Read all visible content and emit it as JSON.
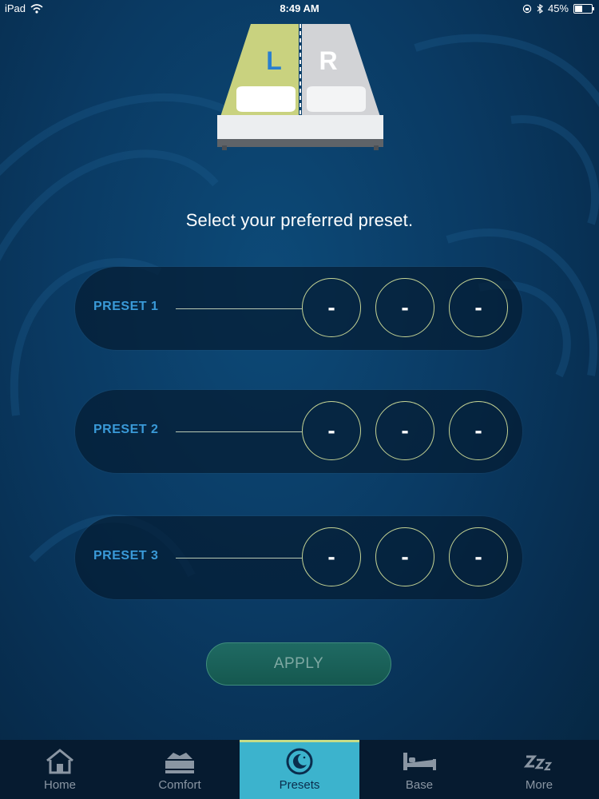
{
  "status_bar": {
    "device": "iPad",
    "time": "8:49 AM",
    "battery": "45%",
    "battery_level": 0.45
  },
  "bed": {
    "left_label": "L",
    "right_label": "R",
    "selected_side": "L"
  },
  "title": "Select your preferred preset.",
  "presets": [
    {
      "label": "PRESET 1",
      "values": [
        "-",
        "-",
        "-"
      ]
    },
    {
      "label": "PRESET 2",
      "values": [
        "-",
        "-",
        "-"
      ]
    },
    {
      "label": "PRESET 3",
      "values": [
        "-",
        "-",
        "-"
      ]
    }
  ],
  "apply_label": "APPLY",
  "tabs": [
    {
      "label": "Home",
      "icon": "home-icon"
    },
    {
      "label": "Comfort",
      "icon": "comfort-icon"
    },
    {
      "label": "Presets",
      "icon": "presets-moon-icon",
      "active": true
    },
    {
      "label": "Base",
      "icon": "bed-base-icon"
    },
    {
      "label": "More",
      "icon": "zzz-icon"
    }
  ],
  "colors": {
    "accent_blue": "#3a9ad8",
    "ring": "#c4d394",
    "active_tab": "#3cb3cd",
    "left_side_highlight": "#c9d27f",
    "apply_button": "#1f6a63"
  }
}
